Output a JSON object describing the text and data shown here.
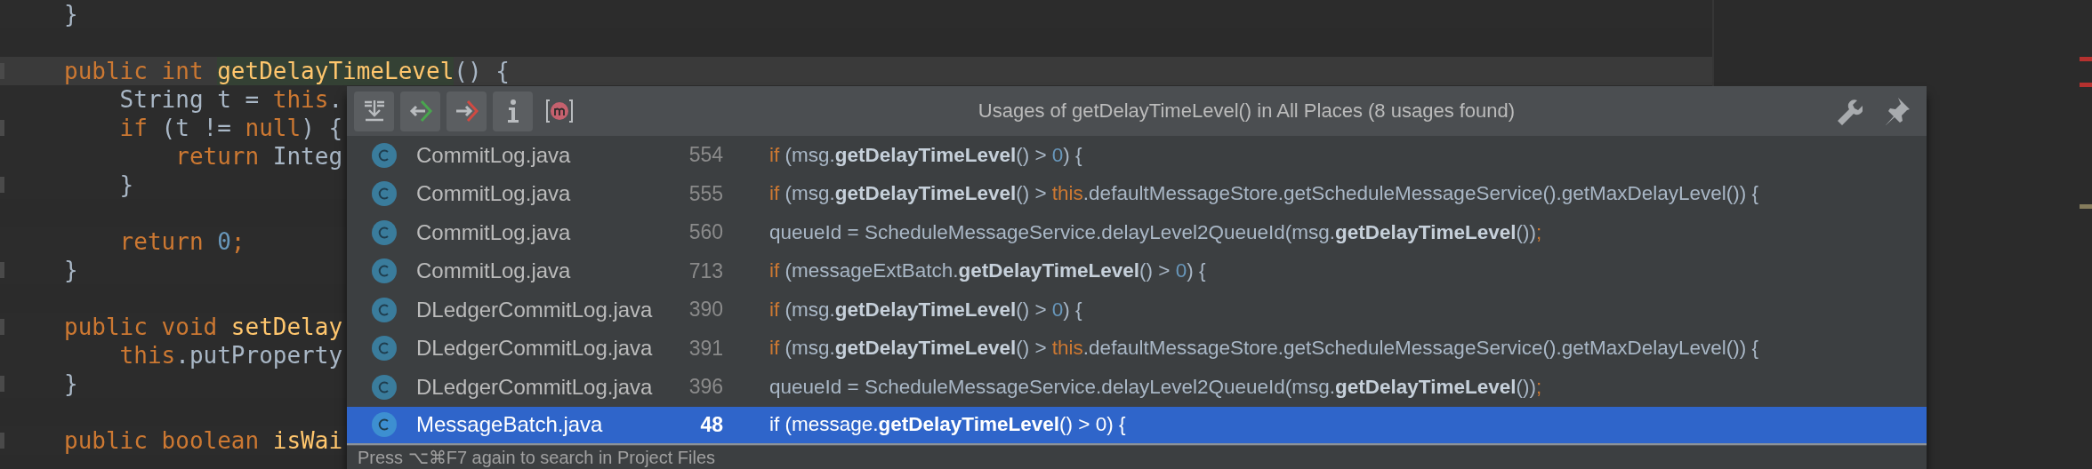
{
  "editor": {
    "blocks": [
      [
        {
          "fold_mark": false,
          "current": false,
          "tokens": [
            {
              "kind": "plain",
              "text": "}"
            }
          ]
        }
      ],
      [
        {
          "fold_mark": true,
          "current": true,
          "tokens": [
            {
              "kind": "keyword",
              "text": "public int "
            },
            {
              "kind": "match",
              "text": "getDelayTimeLevel"
            },
            {
              "kind": "plain",
              "text": "() {"
            }
          ]
        },
        {
          "fold_mark": false,
          "current": false,
          "tokens": [
            {
              "kind": "plain",
              "text": "    String t = "
            },
            {
              "kind": "keyword",
              "text": "this"
            },
            {
              "kind": "plain",
              "text": "."
            }
          ]
        },
        {
          "fold_mark": true,
          "current": false,
          "tokens": [
            {
              "kind": "keyword",
              "text": "    if"
            },
            {
              "kind": "plain",
              "text": " (t != "
            },
            {
              "kind": "keyword",
              "text": "null"
            },
            {
              "kind": "plain",
              "text": ") {"
            }
          ]
        },
        {
          "fold_mark": false,
          "current": false,
          "tokens": [
            {
              "kind": "keyword",
              "text": "        return"
            },
            {
              "kind": "plain",
              "text": " Integ"
            }
          ]
        },
        {
          "fold_mark": true,
          "current": false,
          "tokens": [
            {
              "kind": "plain",
              "text": "    }"
            }
          ]
        }
      ],
      [
        {
          "fold_mark": false,
          "current": false,
          "tokens": [
            {
              "kind": "keyword",
              "text": "    return "
            },
            {
              "kind": "number",
              "text": "0"
            },
            {
              "kind": "keyword",
              "text": ";"
            }
          ]
        },
        {
          "fold_mark": true,
          "current": false,
          "tokens": [
            {
              "kind": "plain",
              "text": "}"
            }
          ]
        }
      ],
      [
        {
          "fold_mark": true,
          "current": false,
          "tokens": [
            {
              "kind": "keyword",
              "text": "public void "
            },
            {
              "kind": "method",
              "text": "setDelay"
            }
          ]
        },
        {
          "fold_mark": false,
          "current": false,
          "tokens": [
            {
              "kind": "keyword",
              "text": "    this"
            },
            {
              "kind": "plain",
              "text": ".putProperty"
            }
          ]
        },
        {
          "fold_mark": true,
          "current": false,
          "tokens": [
            {
              "kind": "plain",
              "text": "}"
            }
          ]
        }
      ],
      [
        {
          "fold_mark": true,
          "current": false,
          "tokens": [
            {
              "kind": "keyword",
              "text": "public boolean "
            },
            {
              "kind": "method",
              "text": "isWai"
            }
          ]
        }
      ]
    ],
    "stripe_markers": [
      {
        "color": "#b5312f"
      },
      {
        "color": "#b5312f"
      },
      {
        "color": "#857c5c"
      }
    ]
  },
  "usages_popup": {
    "toolbar": [
      {
        "kind": "merge",
        "selected": true
      },
      {
        "kind": "previous",
        "selected": true
      },
      {
        "kind": "next",
        "selected": true
      },
      {
        "kind": "info",
        "selected": true
      },
      {
        "kind": "method",
        "selected": false
      }
    ],
    "title": "Usages of getDelayTimeLevel() in All Places (8 usages found)",
    "rows": [
      {
        "file": "CommitLog.java",
        "line": "554",
        "selected": false,
        "code": [
          {
            "kind": "keyword",
            "text": "if"
          },
          {
            "kind": "plain",
            "text": " (msg."
          },
          {
            "kind": "match",
            "text": "getDelayTimeLevel"
          },
          {
            "kind": "plain",
            "text": "() > "
          },
          {
            "kind": "number",
            "text": "0"
          },
          {
            "kind": "plain",
            "text": ") {"
          }
        ]
      },
      {
        "file": "CommitLog.java",
        "line": "555",
        "selected": false,
        "code": [
          {
            "kind": "keyword",
            "text": "if"
          },
          {
            "kind": "plain",
            "text": " (msg."
          },
          {
            "kind": "match",
            "text": "getDelayTimeLevel"
          },
          {
            "kind": "plain",
            "text": "() > "
          },
          {
            "kind": "keyword",
            "text": "this"
          },
          {
            "kind": "plain",
            "text": ".defaultMessageStore.getScheduleMessageService().getMaxDelayLevel()) {"
          }
        ]
      },
      {
        "file": "CommitLog.java",
        "line": "560",
        "selected": false,
        "code": [
          {
            "kind": "plain",
            "text": "queueId = ScheduleMessageService.delayLevel2QueueId(msg."
          },
          {
            "kind": "match",
            "text": "getDelayTimeLevel"
          },
          {
            "kind": "plain",
            "text": "())"
          },
          {
            "kind": "keyword",
            "text": ";"
          }
        ]
      },
      {
        "file": "CommitLog.java",
        "line": "713",
        "selected": false,
        "code": [
          {
            "kind": "keyword",
            "text": "if"
          },
          {
            "kind": "plain",
            "text": " (messageExtBatch."
          },
          {
            "kind": "match",
            "text": "getDelayTimeLevel"
          },
          {
            "kind": "plain",
            "text": "() > "
          },
          {
            "kind": "number",
            "text": "0"
          },
          {
            "kind": "plain",
            "text": ") {"
          }
        ]
      },
      {
        "file": "DLedgerCommitLog.java",
        "line": "390",
        "selected": false,
        "code": [
          {
            "kind": "keyword",
            "text": "if"
          },
          {
            "kind": "plain",
            "text": " (msg."
          },
          {
            "kind": "match",
            "text": "getDelayTimeLevel"
          },
          {
            "kind": "plain",
            "text": "() > "
          },
          {
            "kind": "number",
            "text": "0"
          },
          {
            "kind": "plain",
            "text": ") {"
          }
        ]
      },
      {
        "file": "DLedgerCommitLog.java",
        "line": "391",
        "selected": false,
        "code": [
          {
            "kind": "keyword",
            "text": "if"
          },
          {
            "kind": "plain",
            "text": " (msg."
          },
          {
            "kind": "match",
            "text": "getDelayTimeLevel"
          },
          {
            "kind": "plain",
            "text": "() > "
          },
          {
            "kind": "keyword",
            "text": "this"
          },
          {
            "kind": "plain",
            "text": ".defaultMessageStore.getScheduleMessageService().getMaxDelayLevel()) {"
          }
        ]
      },
      {
        "file": "DLedgerCommitLog.java",
        "line": "396",
        "selected": false,
        "code": [
          {
            "kind": "plain",
            "text": "queueId = ScheduleMessageService.delayLevel2QueueId(msg."
          },
          {
            "kind": "match",
            "text": "getDelayTimeLevel"
          },
          {
            "kind": "plain",
            "text": "())"
          },
          {
            "kind": "keyword",
            "text": ";"
          }
        ]
      },
      {
        "file": "MessageBatch.java",
        "line": "48",
        "selected": true,
        "code": [
          {
            "kind": "keyword",
            "text": "if"
          },
          {
            "kind": "plain",
            "text": " (message."
          },
          {
            "kind": "match",
            "text": "getDelayTimeLevel"
          },
          {
            "kind": "plain",
            "text": "() > "
          },
          {
            "kind": "number",
            "text": "0"
          },
          {
            "kind": "plain",
            "text": ") {"
          }
        ]
      }
    ],
    "footer": "Press ⌥⌘F7 again to search in Project Files"
  }
}
